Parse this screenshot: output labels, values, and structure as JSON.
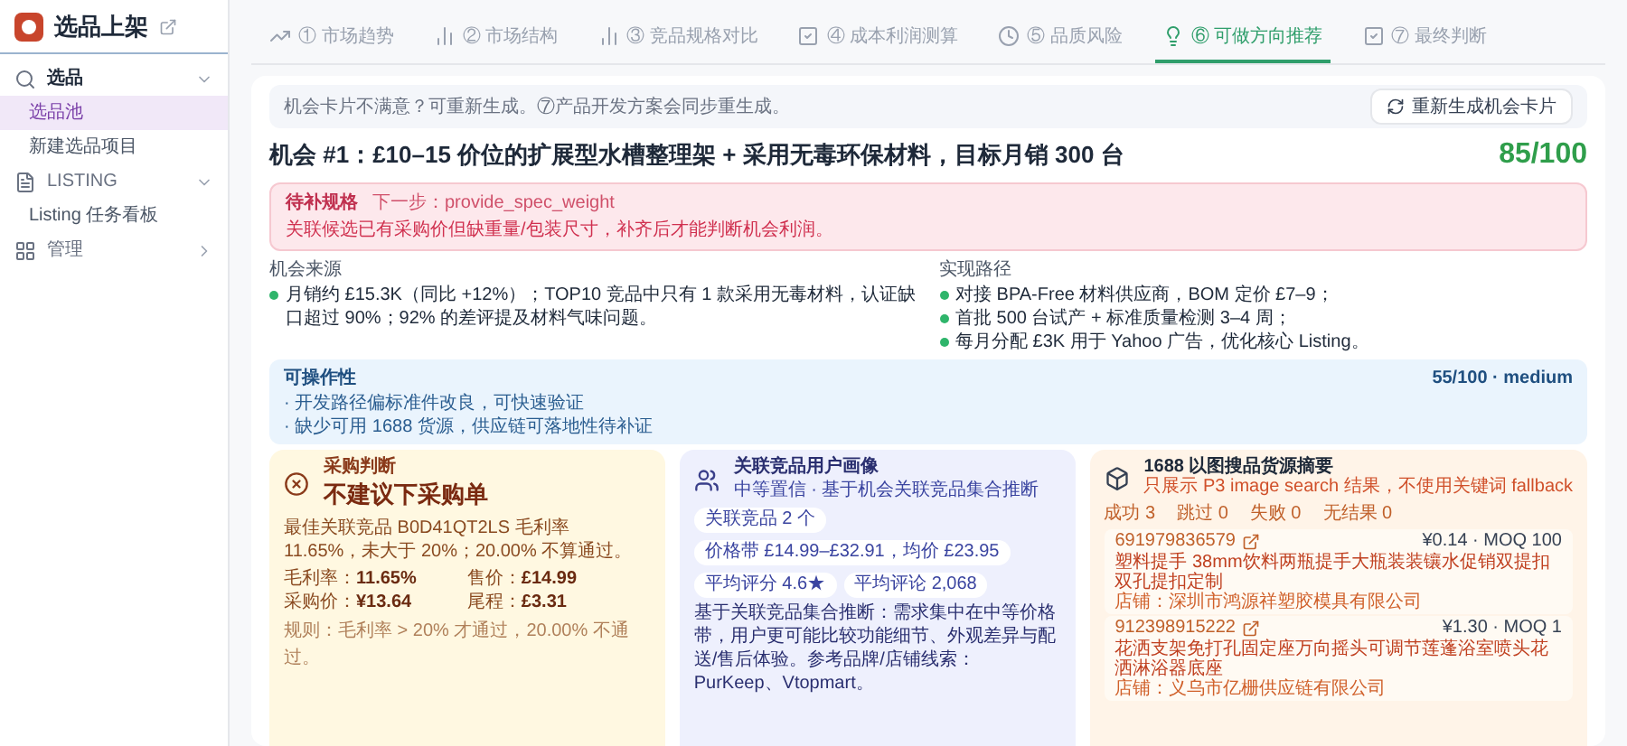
{
  "app": {
    "title": "选品上架"
  },
  "sidebar": {
    "groups": [
      {
        "label": "选品",
        "kind": "search",
        "expanded": true,
        "items": [
          {
            "label": "选品池",
            "selected": true
          },
          {
            "label": "新建选品项目",
            "selected": false
          }
        ]
      },
      {
        "label": "LISTING",
        "kind": "doc",
        "expanded": true,
        "items": [
          {
            "label": "Listing 任务看板",
            "selected": false
          }
        ]
      },
      {
        "label": "管理",
        "kind": "grid",
        "expanded": false
      }
    ]
  },
  "tabs": [
    {
      "label": "① 市场趋势",
      "kind": "trend",
      "selected": false
    },
    {
      "label": "② 市场结构",
      "kind": "bars",
      "selected": false
    },
    {
      "label": "③ 竞品规格对比",
      "kind": "bars",
      "selected": false
    },
    {
      "label": "④ 成本利润测算",
      "kind": "check",
      "selected": false
    },
    {
      "label": "⑤ 品质风险",
      "kind": "clock",
      "selected": false
    },
    {
      "label": "⑥ 可做方向推荐",
      "kind": "bulb",
      "selected": true
    },
    {
      "label": "⑦ 最终判断",
      "kind": "check",
      "selected": false
    }
  ],
  "notice": {
    "text": "机会卡片不满意？可重新生成。⑦产品开发方案会同步重生成。",
    "button": "重新生成机会卡片"
  },
  "opportunity": {
    "title": "机会 #1：£10–15 价位的扩展型水槽整理架 + 采用无毒环保材料，目标月销 300 台",
    "score": "85/100",
    "alert": {
      "tag": "待补规格",
      "next": "下一步：provide_spec_weight",
      "text": "关联候选已有采购价但缺重量/包装尺寸，补齐后才能判断机会利润。"
    },
    "source": {
      "title": "机会来源",
      "items": [
        "月销约 £15.3K（同比 +12%）；TOP10 竞品中只有 1 款采用无毒材料，认证缺口超过 90%；92% 的差评提及材料气味问题。"
      ]
    },
    "path": {
      "title": "实现路径",
      "items": [
        "对接 BPA-Free 材料供应商，BOM 定价 £7–9；",
        "首批 500 台试产 + 标准质量检测 3–4 周；",
        "每月分配 £3K 用于 Yahoo 广告，优化核心 Listing。"
      ]
    },
    "feasibility": {
      "title": "可操作性",
      "score": "55/100 · medium",
      "items": [
        "· 开发路径偏标准件改良，可快速验证",
        "· 缺少可用 1688 货源，供应链可落地性待补证"
      ]
    }
  },
  "purchase": {
    "label": "采购判断",
    "verdict": "不建议下采购单",
    "text": "最佳关联竞品 B0D41QT2LS 毛利率 11.65%，未大于 20%；20.00% 不算通过。",
    "fields": [
      {
        "label": "毛利率：",
        "value": "11.65%"
      },
      {
        "label": "售价：",
        "value": "£14.99"
      },
      {
        "label": "采购价：",
        "value": "¥13.64"
      },
      {
        "label": "尾程：",
        "value": "£3.31"
      }
    ],
    "rule": "规则：毛利率 > 20% 才通过，20.00% 不通过。"
  },
  "persona": {
    "title": "关联竞品用户画像",
    "subtitle": "中等置信 · 基于机会关联竞品集合推断",
    "tags": [
      "关联竞品 2 个",
      "价格带 £14.99–£32.91，均价 £23.95",
      "平均评分 4.6★",
      "平均评论 2,068"
    ],
    "text": "基于关联竞品集合推断：需求集中在中等价格带，用户更可能比较功能细节、外观差异与配送/售后体验。参考品牌/店铺线索：PurKeep、Vtopmart。"
  },
  "sourcing": {
    "title": "1688 以图搜品货源摘要",
    "subtitle": "只展示 P3 image search 结果，不使用关键词 fallback",
    "stats": [
      "成功 3",
      "跳过 0",
      "失败 0",
      "无结果 0"
    ],
    "items": [
      {
        "id": "691979836579",
        "price": "¥0.14 · MOQ 100",
        "name": "塑料提手 38mm饮料两瓶提手大瓶装装镶水促销双提扣双孔提扣定制",
        "shop": "店铺：深圳市鸿源祥塑胶模具有限公司"
      },
      {
        "id": "912398915222",
        "price": "¥1.30 · MOQ 1",
        "name": "花洒支架免打孔固定座万向摇头可调节莲蓬浴室喷头花洒淋浴器底座",
        "shop": "店铺：义乌市亿栅供应链有限公司"
      }
    ]
  }
}
